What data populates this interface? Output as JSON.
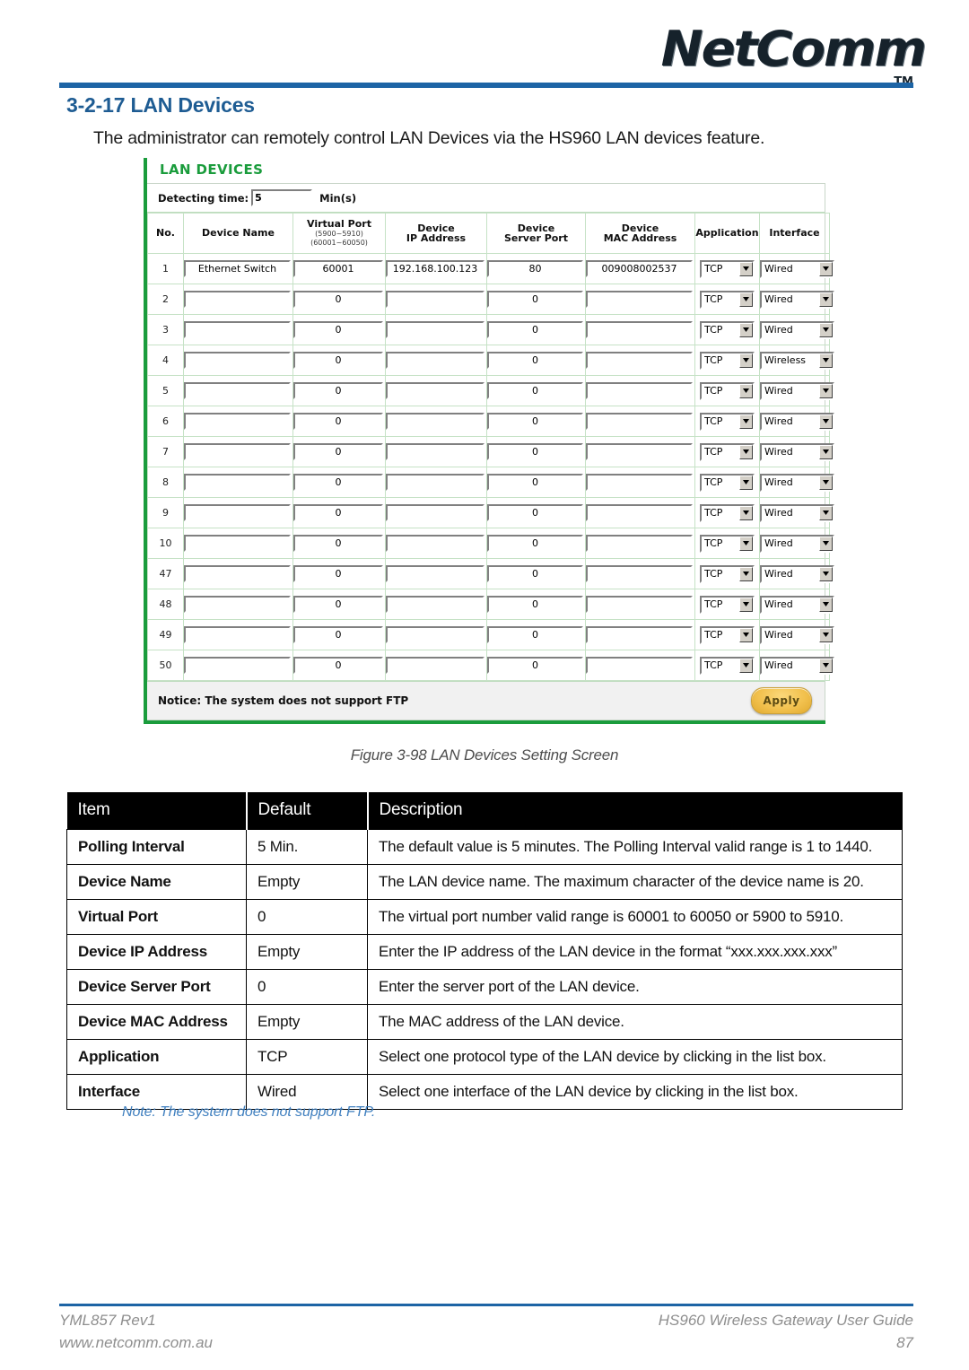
{
  "brand": {
    "logo_text": "NetComm",
    "trademark": "TM"
  },
  "section": {
    "number": "3-2-17",
    "title": "3-2-17 LAN Devices",
    "intro": "The administrator can remotely control LAN Devices via the HS960 LAN devices feature."
  },
  "screenshot": {
    "panel_title": "LAN DEVICES",
    "detecting": {
      "label": "Detecting time:",
      "value": "5",
      "unit": "Min(s)"
    },
    "columns": [
      {
        "label": "No.",
        "sub": ""
      },
      {
        "label": "Device Name",
        "sub": ""
      },
      {
        "label": "Virtual Port",
        "sub": "(5900~5910)",
        "sub2": "(60001~60050)"
      },
      {
        "label": "Device",
        "sub": "IP Address"
      },
      {
        "label": "Device",
        "sub": "Server Port"
      },
      {
        "label": "Device",
        "sub": "MAC Address"
      },
      {
        "label": "Application",
        "sub": ""
      },
      {
        "label": "Interface",
        "sub": ""
      }
    ],
    "rows": [
      {
        "no": "1",
        "name": "Ethernet Switch",
        "vport": "60001",
        "ip": "192.168.100.123",
        "sport": "80",
        "mac": "009008002537",
        "app": "TCP",
        "iface": "Wired"
      },
      {
        "no": "2",
        "name": "",
        "vport": "0",
        "ip": "",
        "sport": "0",
        "mac": "",
        "app": "TCP",
        "iface": "Wired"
      },
      {
        "no": "3",
        "name": "",
        "vport": "0",
        "ip": "",
        "sport": "0",
        "mac": "",
        "app": "TCP",
        "iface": "Wired"
      },
      {
        "no": "4",
        "name": "",
        "vport": "0",
        "ip": "",
        "sport": "0",
        "mac": "",
        "app": "TCP",
        "iface": "Wireless"
      },
      {
        "no": "5",
        "name": "",
        "vport": "0",
        "ip": "",
        "sport": "0",
        "mac": "",
        "app": "TCP",
        "iface": "Wired"
      },
      {
        "no": "6",
        "name": "",
        "vport": "0",
        "ip": "",
        "sport": "0",
        "mac": "",
        "app": "TCP",
        "iface": "Wired"
      },
      {
        "no": "7",
        "name": "",
        "vport": "0",
        "ip": "",
        "sport": "0",
        "mac": "",
        "app": "TCP",
        "iface": "Wired"
      },
      {
        "no": "8",
        "name": "",
        "vport": "0",
        "ip": "",
        "sport": "0",
        "mac": "",
        "app": "TCP",
        "iface": "Wired"
      },
      {
        "no": "9",
        "name": "",
        "vport": "0",
        "ip": "",
        "sport": "0",
        "mac": "",
        "app": "TCP",
        "iface": "Wired"
      },
      {
        "no": "10",
        "name": "",
        "vport": "0",
        "ip": "",
        "sport": "0",
        "mac": "",
        "app": "TCP",
        "iface": "Wired"
      },
      {
        "no": "47",
        "name": "",
        "vport": "0",
        "ip": "",
        "sport": "0",
        "mac": "",
        "app": "TCP",
        "iface": "Wired"
      },
      {
        "no": "48",
        "name": "",
        "vport": "0",
        "ip": "",
        "sport": "0",
        "mac": "",
        "app": "TCP",
        "iface": "Wired"
      },
      {
        "no": "49",
        "name": "",
        "vport": "0",
        "ip": "",
        "sport": "0",
        "mac": "",
        "app": "TCP",
        "iface": "Wired"
      },
      {
        "no": "50",
        "name": "",
        "vport": "0",
        "ip": "",
        "sport": "0",
        "mac": "",
        "app": "TCP",
        "iface": "Wired"
      }
    ],
    "notice": "Notice: The system does not support FTP",
    "apply_label": "Apply",
    "accent_green": "#1a9c3c",
    "apply_color": "#f2c14e"
  },
  "figure_caption": "Figure 3-98 LAN Devices Setting Screen",
  "description_table": {
    "headers": [
      "Item",
      "Default",
      "Description"
    ],
    "rows": [
      {
        "item": "Polling Interval",
        "default": "5 Min.",
        "description": "The default value is 5 minutes. The Polling Interval valid range is 1 to 1440."
      },
      {
        "item": "Device Name",
        "default": "Empty",
        "description": "The LAN device name. The maximum character of the device name is 20."
      },
      {
        "item": "Virtual Port",
        "default": "0",
        "description": "The virtual port number valid range is 60001 to 60050 or 5900 to 5910."
      },
      {
        "item": "Device IP Address",
        "default": "Empty",
        "description": "Enter the IP address of the LAN device in the format “xxx.xxx.xxx.xxx”"
      },
      {
        "item": "Device Server Port",
        "default": "0",
        "description": "Enter the server port of the LAN device."
      },
      {
        "item": "Device MAC Address",
        "default": "Empty",
        "description": "The MAC address of the LAN device."
      },
      {
        "item": "Application",
        "default": "TCP",
        "description": "Select one protocol type of the LAN device by clicking in the list box."
      },
      {
        "item": "Interface",
        "default": "Wired",
        "description": "Select one interface of the LAN device by clicking in the list box."
      }
    ]
  },
  "note": "Note: The system does not support FTP.",
  "footer": {
    "doc_id": "YML857 Rev1",
    "website": "www.netcomm.com.au",
    "guide": "HS960 Wireless Gateway User Guide",
    "page": "87"
  }
}
